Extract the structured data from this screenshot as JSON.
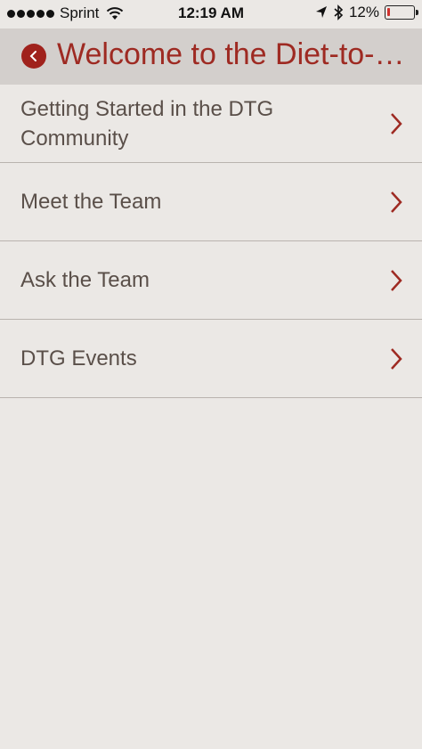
{
  "status_bar": {
    "carrier": "Sprint",
    "time": "12:19 AM",
    "battery_percent": "12%",
    "battery_level": 0.12
  },
  "nav": {
    "title": "Welcome to the Diet-to-Go Community",
    "back_icon": "chevron-left-icon"
  },
  "menu": {
    "items": [
      {
        "label": "Getting Started in the DTG Community"
      },
      {
        "label": "Meet the Team"
      },
      {
        "label": "Ask the Team"
      },
      {
        "label": "DTG Events"
      }
    ]
  },
  "colors": {
    "accent": "#9e2a22",
    "background": "#ebe8e5",
    "nav_background": "#d3cfcc",
    "text": "#5a4f49"
  }
}
